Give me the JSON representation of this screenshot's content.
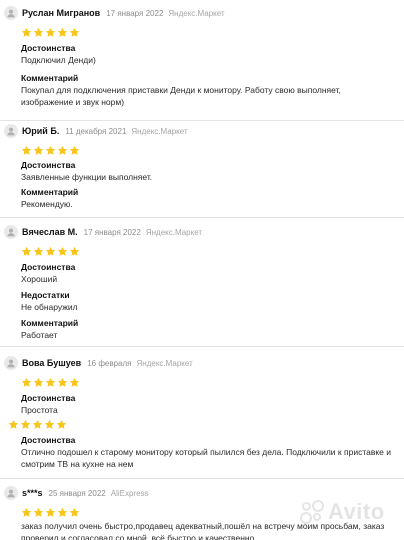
{
  "reviews": [
    {
      "author": "Руслан Мигранов",
      "date": "17 января 2022",
      "source": "Яндекс.Маркет",
      "rating": 5,
      "sections": [
        {
          "label": "Достоинства",
          "text": "Подключил Денди)"
        },
        {
          "label": "Комментарий",
          "text": "Покупал для подключения приставки Денди к монитору. Работу свою выполняет, изображение и звук норм)"
        }
      ]
    },
    {
      "author": "Юрий Б.",
      "date": "11 декабря 2021",
      "source": "Яндекс.Маркет",
      "rating": 5,
      "sections": [
        {
          "label": "Достоинства",
          "text": "Заявленные функции выполняет."
        },
        {
          "label": "Комментарий",
          "text": "Рекомендую."
        }
      ]
    },
    {
      "author": "Вячеслав М.",
      "date": "17 января 2022",
      "source": "Яндекс.Маркет",
      "rating": 5,
      "sections": [
        {
          "label": "Достоинства",
          "text": "Хороший"
        },
        {
          "label": "Недостатки",
          "text": "Не обнаружил"
        },
        {
          "label": "Комментарий",
          "text": "Работает"
        }
      ]
    },
    {
      "author": "Вова Бушуев",
      "date": "16 февраля",
      "source": "Яндекс.Маркет",
      "rating": 5,
      "sections": [
        {
          "label": "Достоинства",
          "text": "Простота"
        }
      ],
      "extra_rating": 5,
      "extra_sections": [
        {
          "label": "Достоинства",
          "text": "Отлично подошел к старому монитору который пылился без дела. Подключили к приставке и смотрим ТВ на кухне на нем"
        }
      ]
    },
    {
      "author": "s***s",
      "date": "25 января 2022",
      "source": "AliExpress",
      "rating": 5,
      "sections": [
        {
          "label": "",
          "text": "заказ получил очень быстро,продавец адекватный,пошёл на встречу моим просьбам, заказ проверил и согласовал со мной. всё быстро и качественно."
        }
      ]
    }
  ],
  "watermark": {
    "text": "Avito"
  },
  "colors": {
    "star": "#f8c51b",
    "label": "#111111",
    "meta": "#8c8c8c"
  }
}
